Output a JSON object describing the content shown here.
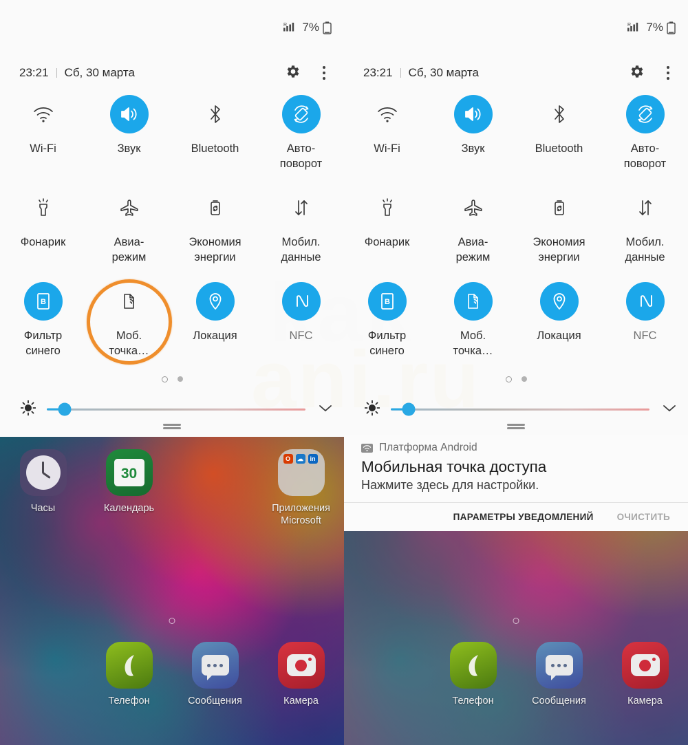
{
  "status_bar": {
    "signal_icon": "signal-roaming-icon",
    "battery_percent": "7%",
    "battery_icon": "battery-low-icon"
  },
  "quick_settings": {
    "time": "23:21",
    "date": "Сб, 30 марта",
    "gear_icon": "gear-icon",
    "overflow_icon": "more-vertical-icon",
    "tiles_left": [
      {
        "label": "Wi-Fi",
        "icon": "wifi-icon",
        "active": false
      },
      {
        "label": "Звук",
        "icon": "sound-icon",
        "active": true
      },
      {
        "label": "Bluetooth",
        "icon": "bluetooth-icon",
        "active": false
      },
      {
        "label": "Авто-\nповорот",
        "icon": "auto-rotate-icon",
        "active": true
      },
      {
        "label": "Фонарик",
        "icon": "flashlight-icon",
        "active": false
      },
      {
        "label": "Авиа-\nрежим",
        "icon": "airplane-icon",
        "active": false
      },
      {
        "label": "Экономия\nэнергии",
        "icon": "power-saving-icon",
        "active": false
      },
      {
        "label": "Мобил.\nданные",
        "icon": "mobile-data-icon",
        "active": false
      },
      {
        "label": "Фильтр\nсинего",
        "icon": "blue-filter-icon",
        "active": true
      },
      {
        "label": "Моб.\nточка…",
        "icon": "hotspot-icon",
        "active": false
      },
      {
        "label": "Локация",
        "icon": "location-icon",
        "active": true
      },
      {
        "label": "NFC",
        "icon": "nfc-icon",
        "active": true
      }
    ],
    "tiles_right": [
      {
        "label": "Wi-Fi",
        "icon": "wifi-icon",
        "active": false
      },
      {
        "label": "Звук",
        "icon": "sound-icon",
        "active": true
      },
      {
        "label": "Bluetooth",
        "icon": "bluetooth-icon",
        "active": false
      },
      {
        "label": "Авто-\nповорот",
        "icon": "auto-rotate-icon",
        "active": true
      },
      {
        "label": "Фонарик",
        "icon": "flashlight-icon",
        "active": false
      },
      {
        "label": "Авиа-\nрежим",
        "icon": "airplane-icon",
        "active": false
      },
      {
        "label": "Экономия\nэнергии",
        "icon": "power-saving-icon",
        "active": false
      },
      {
        "label": "Мобил.\nданные",
        "icon": "mobile-data-icon",
        "active": false
      },
      {
        "label": "Фильтр\nсинего",
        "icon": "blue-filter-icon",
        "active": true
      },
      {
        "label": "Моб.\nточка…",
        "icon": "hotspot-icon",
        "active": true
      },
      {
        "label": "Локация",
        "icon": "location-icon",
        "active": true
      },
      {
        "label": "NFC",
        "icon": "nfc-icon",
        "active": true
      }
    ],
    "brightness": {
      "icon": "brightness-icon",
      "value_percent": 7,
      "expand_icon": "chevron-down-icon"
    },
    "page_dots": {
      "count": 2,
      "active_index": 0
    }
  },
  "notification": {
    "app_icon": "wifi-tether-icon",
    "app_name": "Платформа Android",
    "title": "Мобильная точка доступа",
    "subtitle": "Нажмите здесь для настройки.",
    "action_settings": "ПАРАМЕТРЫ УВЕДОМЛЕНИЙ",
    "action_clear": "ОЧИСТИТЬ"
  },
  "home_screen": {
    "apps_row1": [
      {
        "label": "Часы",
        "icon": "clock-app-icon"
      },
      {
        "label": "Календарь",
        "icon": "calendar-app-icon",
        "badge": "30"
      },
      {
        "label": "",
        "icon": "empty-slot"
      },
      {
        "label": "Приложения\nMicrosoft",
        "icon": "microsoft-apps-folder-icon"
      }
    ],
    "apps_row2": [
      {
        "label": "",
        "icon": "empty-slot"
      },
      {
        "label": "Телефон",
        "icon": "phone-app-icon"
      },
      {
        "label": "Сообщения",
        "icon": "messages-app-icon"
      },
      {
        "label": "Камера",
        "icon": "camera-app-icon"
      }
    ]
  },
  "annotation": {
    "highlight_target": "Моб. точка…",
    "highlight_color": "#ef8e2c",
    "highlight_shape": "circle"
  },
  "watermark": {
    "line1": "kak",
    "line2": "ani.ru"
  },
  "colors": {
    "tile_active": "#1ba7ea",
    "shade_bg": "#fafafa",
    "highlight": "#ef8e2c",
    "slider_knob": "#29a8e4"
  }
}
